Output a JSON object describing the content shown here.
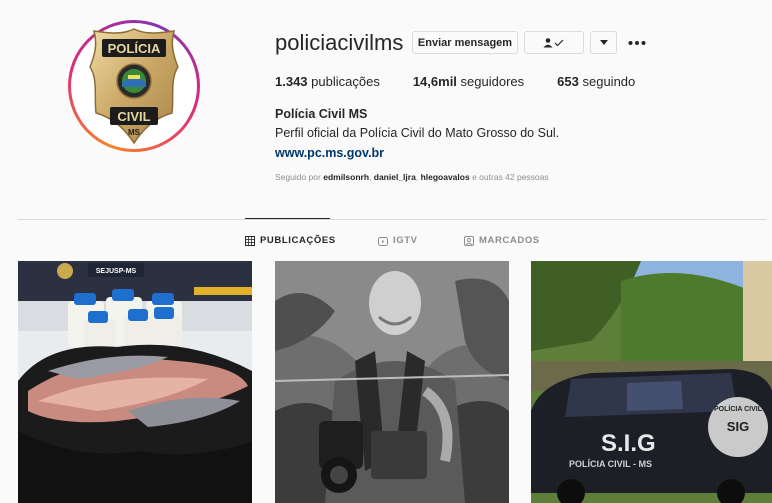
{
  "profile": {
    "username": "policiacivilms",
    "buttons": {
      "message": "Enviar mensagem"
    },
    "stats": {
      "posts_count": "1.343",
      "posts_label": "publicações",
      "followers_count": "14,6mil",
      "followers_label": "seguidores",
      "following_count": "653",
      "following_label": "seguindo"
    },
    "full_name": "Polícia Civil MS",
    "bio": "Perfil oficial da Polícia Civil do Mato Grosso do Sul.",
    "website": "www.pc.ms.gov.br",
    "followed_by": {
      "prefix": "Seguido por",
      "users": [
        "edmilsonrh",
        "daniel_ljra",
        "hlegoavalos"
      ],
      "suffix": "e outras 42 pessoas"
    },
    "avatar_text": {
      "top": "POLÍCIA",
      "bottom": "CIVIL",
      "state": "MS"
    }
  },
  "tabs": [
    {
      "label": "PUBLICAÇÕES",
      "icon": "grid-icon",
      "active": true
    },
    {
      "label": "IGTV",
      "icon": "igtv-icon",
      "active": false
    },
    {
      "label": "MARCADOS",
      "icon": "tagged-icon",
      "active": false
    }
  ],
  "posts": [
    {
      "description_icon": "seized-fish-photo",
      "sign_text": "SEJUSP-MS"
    },
    {
      "description_icon": "photographer-photo"
    },
    {
      "description_icon": "police-vehicle-photo",
      "door_text": "S.I.G",
      "door_subtext": "POLÍCIA CIVIL - MS",
      "badge_text": "SIG",
      "badge_ring_text": "POLÍCIA CIVIL"
    }
  ],
  "colors": {
    "link": "#00376b",
    "muted": "#8e8e8e",
    "ring_start": "#f58529",
    "ring_mid": "#dd2a7b"
  }
}
